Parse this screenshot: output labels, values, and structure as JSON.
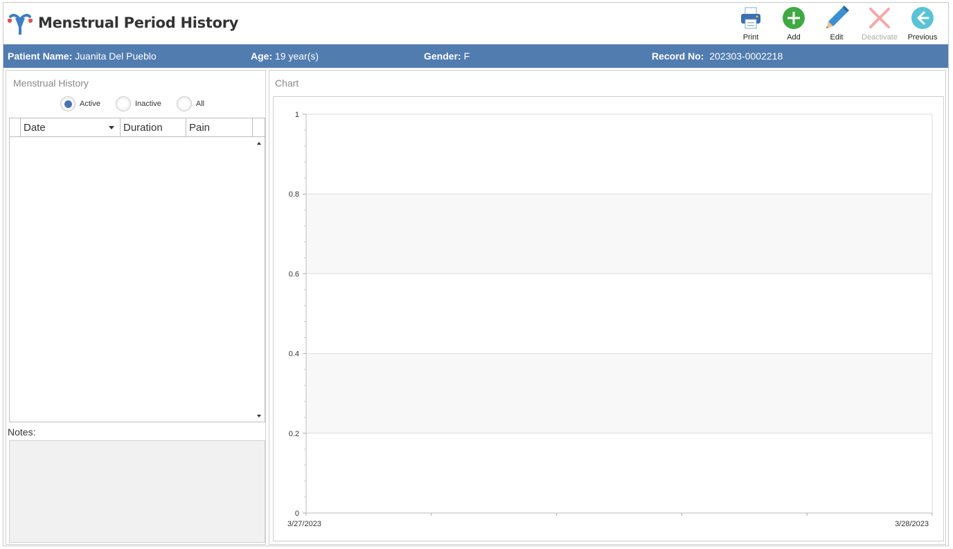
{
  "header": {
    "title": "Menstrual Period History",
    "logo_icon": "uterus-icon"
  },
  "toolbar": {
    "print_label": "Print",
    "add_label": "Add",
    "edit_label": "Edit",
    "deactivate_label": "Deactivate",
    "previous_label": "Previous"
  },
  "patient": {
    "name_label": "Patient Name:",
    "name_value": "Juanita Del Pueblo",
    "age_label": "Age:",
    "age_value": "19 year(s)",
    "gender_label": "Gender:",
    "gender_value": "F",
    "record_label": "Record No:",
    "record_value": "202303-0002218"
  },
  "history": {
    "title": "Menstrual History",
    "filters": [
      {
        "label": "Active",
        "selected": true
      },
      {
        "label": "Inactive",
        "selected": false
      },
      {
        "label": "All",
        "selected": false
      }
    ],
    "columns": [
      "Date",
      "Duration",
      "Pain"
    ],
    "rows": [],
    "notes_label": "Notes:",
    "notes_value": ""
  },
  "chart_panel": {
    "title": "Chart"
  },
  "chart_data": {
    "type": "line",
    "x_ticks": [
      "3/27/2023",
      "3/28/2023"
    ],
    "y_ticks": [
      "0",
      "0.2",
      "0.4",
      "0.6",
      "0.8",
      "1"
    ],
    "ylim": [
      0,
      1
    ],
    "series": [],
    "grid": true
  },
  "colors": {
    "patient_bar": "#517caf",
    "radio_selected": "#4a73b2",
    "add_green": "#3fa944",
    "previous_teal": "#5bc3d6",
    "deactivate_red": "#f4a9a9",
    "chart_band": "#f8f8f8"
  }
}
